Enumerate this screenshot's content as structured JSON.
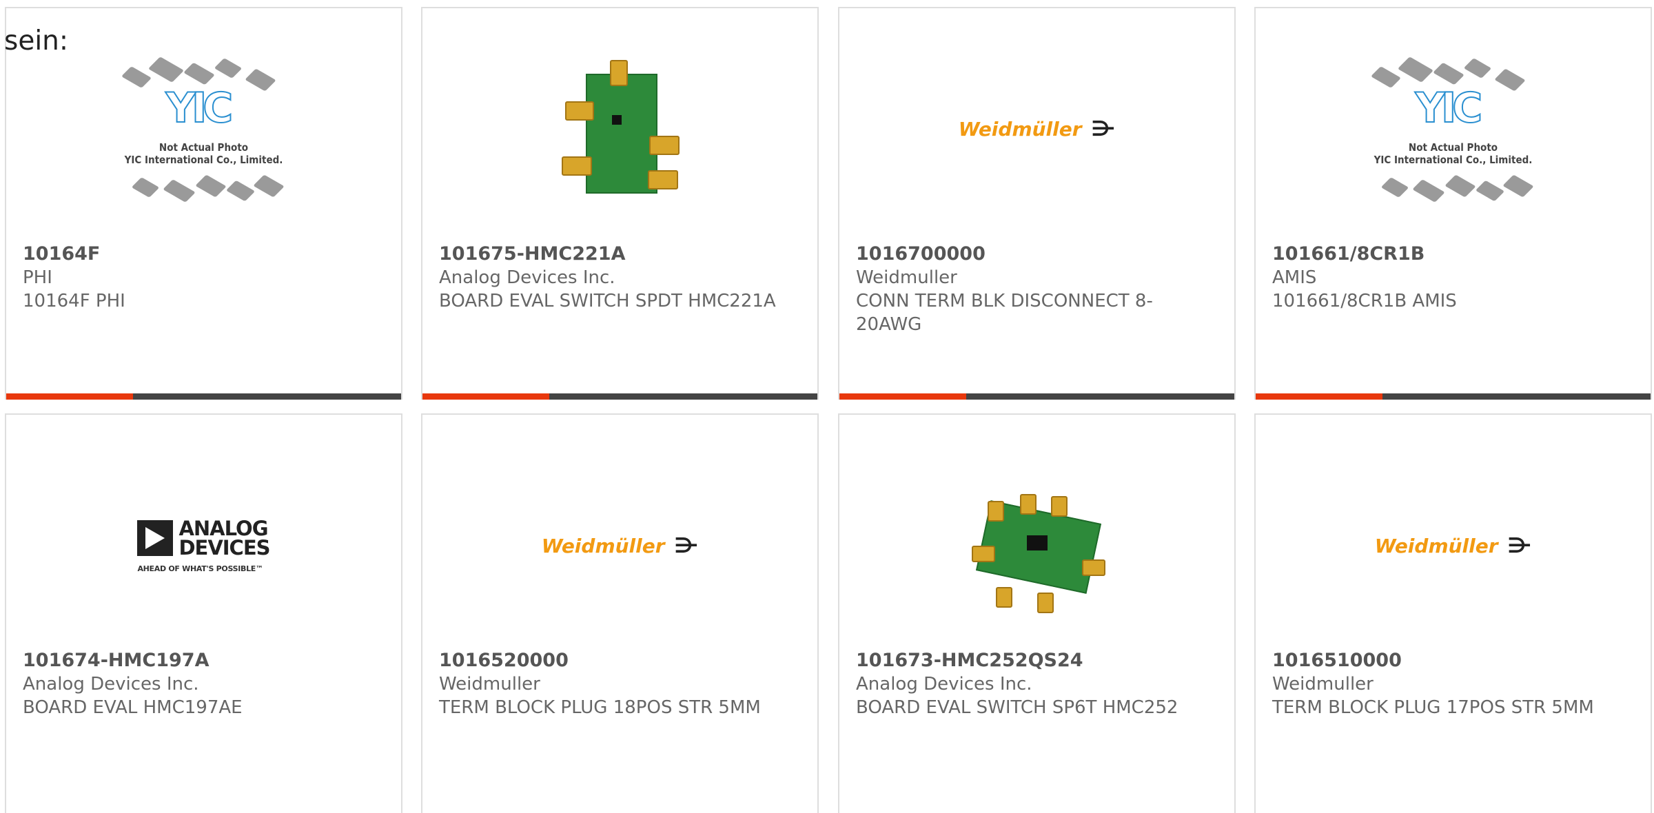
{
  "heading": "sein:",
  "cards": [
    {
      "part_number": "10164F",
      "manufacturer": "PHI",
      "description": "10164F PHI",
      "image": "placeholder-not-actual-photo",
      "image_text": {
        "line1": "Not Actual Photo",
        "line2": "YIC International Co., Limited."
      }
    },
    {
      "part_number": "101675-HMC221A",
      "manufacturer": "Analog Devices Inc.",
      "description": "BOARD EVAL SWITCH SPDT HMC221A",
      "image": "eval-board-photo"
    },
    {
      "part_number": "1016700000",
      "manufacturer": "Weidmuller",
      "description": "CONN TERM BLK DISCONNECT 8-20AWG",
      "image": "weidmuller-logo",
      "image_text": {
        "logo": "Weidmüller"
      }
    },
    {
      "part_number": "101661/8CR1B",
      "manufacturer": "AMIS",
      "description": "101661/8CR1B AMIS",
      "image": "placeholder-not-actual-photo",
      "image_text": {
        "line1": "Not Actual Photo",
        "line2": "YIC International Co., Limited."
      }
    },
    {
      "part_number": "101674-HMC197A",
      "manufacturer": "Analog Devices Inc.",
      "description": "BOARD EVAL HMC197AE",
      "image": "analog-devices-logo",
      "image_text": {
        "line1": "ANALOG",
        "line2": "DEVICES",
        "tagline": "AHEAD OF WHAT'S POSSIBLE™"
      }
    },
    {
      "part_number": "1016520000",
      "manufacturer": "Weidmuller",
      "description": "TERM BLOCK PLUG 18POS STR 5MM",
      "image": "weidmuller-logo",
      "image_text": {
        "logo": "Weidmüller"
      }
    },
    {
      "part_number": "101673-HMC252QS24",
      "manufacturer": "Analog Devices Inc.",
      "description": "BOARD EVAL SWITCH SP6T HMC252",
      "image": "eval-board-photo"
    },
    {
      "part_number": "1016510000",
      "manufacturer": "Weidmuller",
      "description": "TERM BLOCK PLUG 17POS STR 5MM",
      "image": "weidmuller-logo",
      "image_text": {
        "logo": "Weidmüller"
      }
    }
  ],
  "colors": {
    "accent": "#e8380d",
    "bar": "#444444",
    "border": "#dedede",
    "logo_orange": "#f29a12"
  }
}
